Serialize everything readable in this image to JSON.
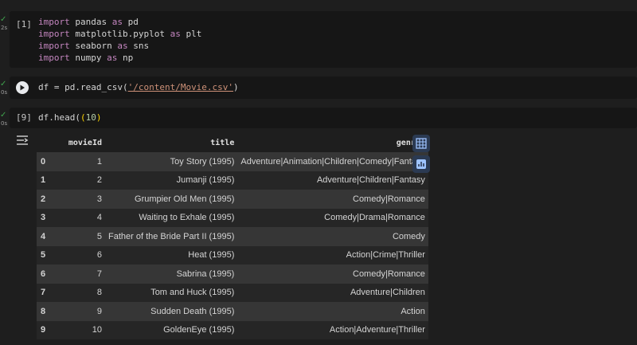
{
  "cells": [
    {
      "exec_count": "[1]",
      "time": "2s",
      "code_lines": [
        {
          "kw": "import",
          "rest": " pandas ",
          "kw2": "as",
          "rest2": " pd"
        },
        {
          "kw": "import",
          "rest": " matplotlib.pyplot ",
          "kw2": "as",
          "rest2": " plt"
        },
        {
          "kw": "import",
          "rest": " seaborn ",
          "kw2": "as",
          "rest2": " sns"
        },
        {
          "kw": "import",
          "rest": " numpy ",
          "kw2": "as",
          "rest2": " np"
        }
      ]
    },
    {
      "time": "0s",
      "code_prefix": "df = pd.read_csv(",
      "code_string": "'/content/Movie.csv'",
      "code_suffix": ")"
    },
    {
      "exec_count": "[9]",
      "time": "0s",
      "code_prefix": "df.head(",
      "code_num": "10",
      "code_suffix": ")"
    }
  ],
  "table": {
    "columns": [
      "",
      "movieId",
      "title",
      "genres"
    ],
    "rows": [
      [
        "0",
        "1",
        "Toy Story (1995)",
        "Adventure|Animation|Children|Comedy|Fantasy"
      ],
      [
        "1",
        "2",
        "Jumanji (1995)",
        "Adventure|Children|Fantasy"
      ],
      [
        "2",
        "3",
        "Grumpier Old Men (1995)",
        "Comedy|Romance"
      ],
      [
        "3",
        "4",
        "Waiting to Exhale (1995)",
        "Comedy|Drama|Romance"
      ],
      [
        "4",
        "5",
        "Father of the Bride Part II (1995)",
        "Comedy"
      ],
      [
        "5",
        "6",
        "Heat (1995)",
        "Action|Crime|Thriller"
      ],
      [
        "6",
        "7",
        "Sabrina (1995)",
        "Comedy|Romance"
      ],
      [
        "7",
        "8",
        "Tom and Huck (1995)",
        "Adventure|Children"
      ],
      [
        "8",
        "9",
        "Sudden Death (1995)",
        "Action"
      ],
      [
        "9",
        "10",
        "GoldenEye (1995)",
        "Action|Adventure|Thriller"
      ]
    ]
  },
  "icons": {
    "check": "check-icon",
    "play": "play-icon",
    "output": "output-toggle-icon",
    "table_view": "table-view-icon",
    "chart_suggest": "chart-suggest-icon"
  },
  "colors": {
    "background": "#1e1e1e",
    "code_bg": "#161616",
    "keyword": "#c586c0",
    "string": "#ce9178",
    "success": "#3fa34d"
  }
}
